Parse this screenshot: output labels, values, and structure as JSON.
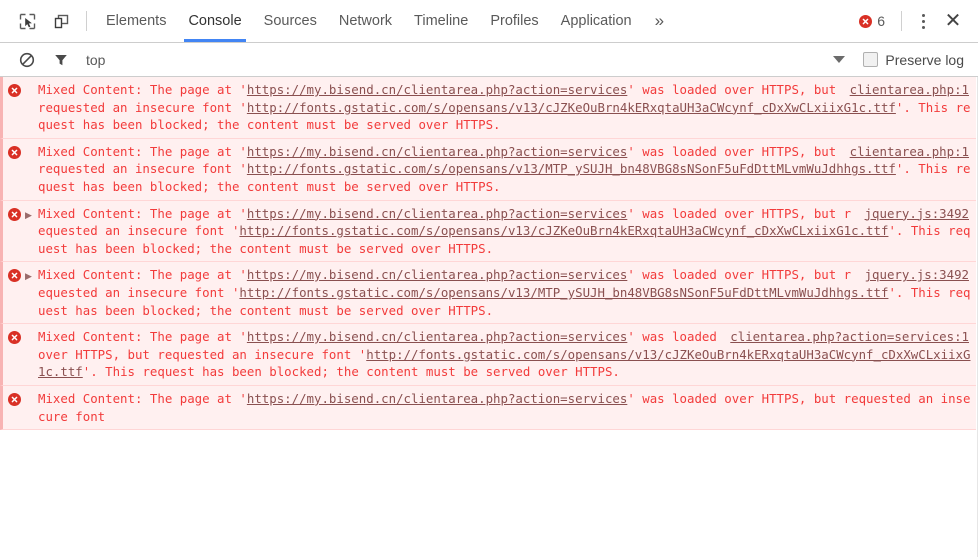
{
  "toolbar": {
    "inspect_icon": "inspect-cursor-icon",
    "device_icon": "device-toolbar-icon",
    "tabs": [
      {
        "label": "Elements",
        "active": false
      },
      {
        "label": "Console",
        "active": true
      },
      {
        "label": "Sources",
        "active": false
      },
      {
        "label": "Network",
        "active": false
      },
      {
        "label": "Timeline",
        "active": false
      },
      {
        "label": "Profiles",
        "active": false
      },
      {
        "label": "Application",
        "active": false
      }
    ],
    "more_tabs_label": "»",
    "error_count": "6",
    "menu_icon": "vertical-dots-icon",
    "close_label": "✕",
    "accent_color": "#4285f4",
    "error_color": "#d93025"
  },
  "filter_bar": {
    "clear_icon": "clear-console-icon",
    "filter_icon": "filter-funnel-icon",
    "context_value": "top",
    "context_caret": "caret-down-icon",
    "level_caret": "caret-down-icon",
    "preserve_log_label": "Preserve log",
    "preserve_log_checked": false
  },
  "console": {
    "message_color": "#f23b3b",
    "background_color": "#fff0f0",
    "link_color": "#8a5050",
    "messages": [
      {
        "level": "error",
        "expandable": false,
        "source": "clientarea.php:1",
        "parts": [
          {
            "t": "Mixed Content: The page at '",
            "link": false
          },
          {
            "t": "https://my.bisend.cn/clientarea.php?action=services",
            "link": true
          },
          {
            "t": "' was loaded over HTTPS, but requested an insecure font '",
            "link": false
          },
          {
            "t": "http://fonts.gstatic.com/s/opensans/v13/cJZKeOuBrn4kERxqtaUH3aCWcynf_cDxXwCLxiixG1c.ttf",
            "link": true
          },
          {
            "t": "'. This request has been blocked; the content must be served over HTTPS.",
            "link": false
          }
        ]
      },
      {
        "level": "error",
        "expandable": false,
        "source": "clientarea.php:1",
        "parts": [
          {
            "t": "Mixed Content: The page at '",
            "link": false
          },
          {
            "t": "https://my.bisend.cn/clientarea.php?action=services",
            "link": true
          },
          {
            "t": "' was loaded over HTTPS, but requested an insecure font '",
            "link": false
          },
          {
            "t": "http://fonts.gstatic.com/s/opensans/v13/MTP_ySUJH_bn48VBG8sNSonF5uFdDttMLvmWuJdhhgs.ttf",
            "link": true
          },
          {
            "t": "'. This request has been blocked; the content must be served over HTTPS.",
            "link": false
          }
        ]
      },
      {
        "level": "error",
        "expandable": true,
        "source": "jquery.js:3492",
        "parts": [
          {
            "t": "Mixed Content: The page at '",
            "link": false
          },
          {
            "t": "https://my.bisend.cn/clientarea.php?action=services",
            "link": true
          },
          {
            "t": "' was loaded over HTTPS, but requested an insecure font '",
            "link": false
          },
          {
            "t": "http://fonts.gstatic.com/s/opensans/v13/cJZKeOuBrn4kERxqtaUH3aCWcynf_cDxXwCLxiixG1c.ttf",
            "link": true
          },
          {
            "t": "'. This request has been blocked; the content must be served over HTTPS.",
            "link": false
          }
        ]
      },
      {
        "level": "error",
        "expandable": true,
        "source": "jquery.js:3492",
        "parts": [
          {
            "t": "Mixed Content: The page at '",
            "link": false
          },
          {
            "t": "https://my.bisend.cn/clientarea.php?action=services",
            "link": true
          },
          {
            "t": "' was loaded over HTTPS, but requested an insecure font '",
            "link": false
          },
          {
            "t": "http://fonts.gstatic.com/s/opensans/v13/MTP_ySUJH_bn48VBG8sNSonF5uFdDttMLvmWuJdhhgs.ttf",
            "link": true
          },
          {
            "t": "'. This request has been blocked; the content must be served over HTTPS.",
            "link": false
          }
        ]
      },
      {
        "level": "error",
        "expandable": false,
        "source": "clientarea.php?action=services:1",
        "parts": [
          {
            "t": "Mixed Content: The page at '",
            "link": false
          },
          {
            "t": "https://my.bisend.cn/clientarea.php?action=services",
            "link": true
          },
          {
            "t": "' was loaded over HTTPS, but requested an insecure font '",
            "link": false
          },
          {
            "t": "http://fonts.gstatic.com/s/opensans/v13/cJZKeOuBrn4kERxqtaUH3aCWcynf_cDxXwCLxiixG1c.ttf",
            "link": true
          },
          {
            "t": "'. This request has been blocked; the content must be served over HTTPS.",
            "link": false
          }
        ]
      },
      {
        "level": "error",
        "expandable": false,
        "source": "",
        "parts": [
          {
            "t": "Mixed Content: The page at '",
            "link": false
          },
          {
            "t": "https://my.bisend.cn/clientarea.php?action=services",
            "link": true
          },
          {
            "t": "' was loaded over HTTPS, but requested an insecure font",
            "link": false
          }
        ]
      }
    ]
  }
}
